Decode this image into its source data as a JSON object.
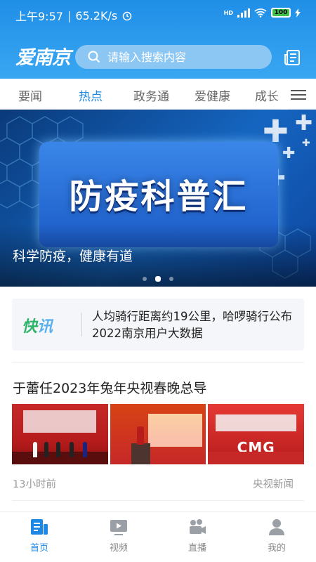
{
  "status_bar": {
    "time": "上午9:57",
    "speed": "65.2K/s",
    "network": "HD",
    "battery": "100"
  },
  "header": {
    "logo": "爱南京",
    "search_placeholder": "请输入搜索内容"
  },
  "tabs": [
    {
      "label": "要闻",
      "active": false
    },
    {
      "label": "热点",
      "active": true
    },
    {
      "label": "政务通",
      "active": false
    },
    {
      "label": "爱健康",
      "active": false
    },
    {
      "label": "成长",
      "active": false
    }
  ],
  "banner": {
    "card_title": "防疫科普汇",
    "caption": "科学防疫，健康有道",
    "slides": 3,
    "active_slide": 2
  },
  "flash": {
    "tag_a": "快",
    "tag_b": "讯",
    "text": "人均骑行距离约19公里，哈啰骑行公布2022南京用户大数据"
  },
  "article": {
    "title": "于蕾任2023年兔年央视春晚总导",
    "time": "13小时前",
    "source": "央视新闻",
    "image3_text": "CMG"
  },
  "bottom_nav": [
    {
      "label": "首页",
      "icon": "home-icon",
      "active": true
    },
    {
      "label": "视频",
      "icon": "video-icon",
      "active": false
    },
    {
      "label": "直播",
      "icon": "live-camera-icon",
      "active": false
    },
    {
      "label": "我的",
      "icon": "profile-icon",
      "active": false
    }
  ],
  "colors": {
    "accent": "#1e88e5",
    "header": "#2a9bee",
    "flash_green": "#2fb36a"
  }
}
